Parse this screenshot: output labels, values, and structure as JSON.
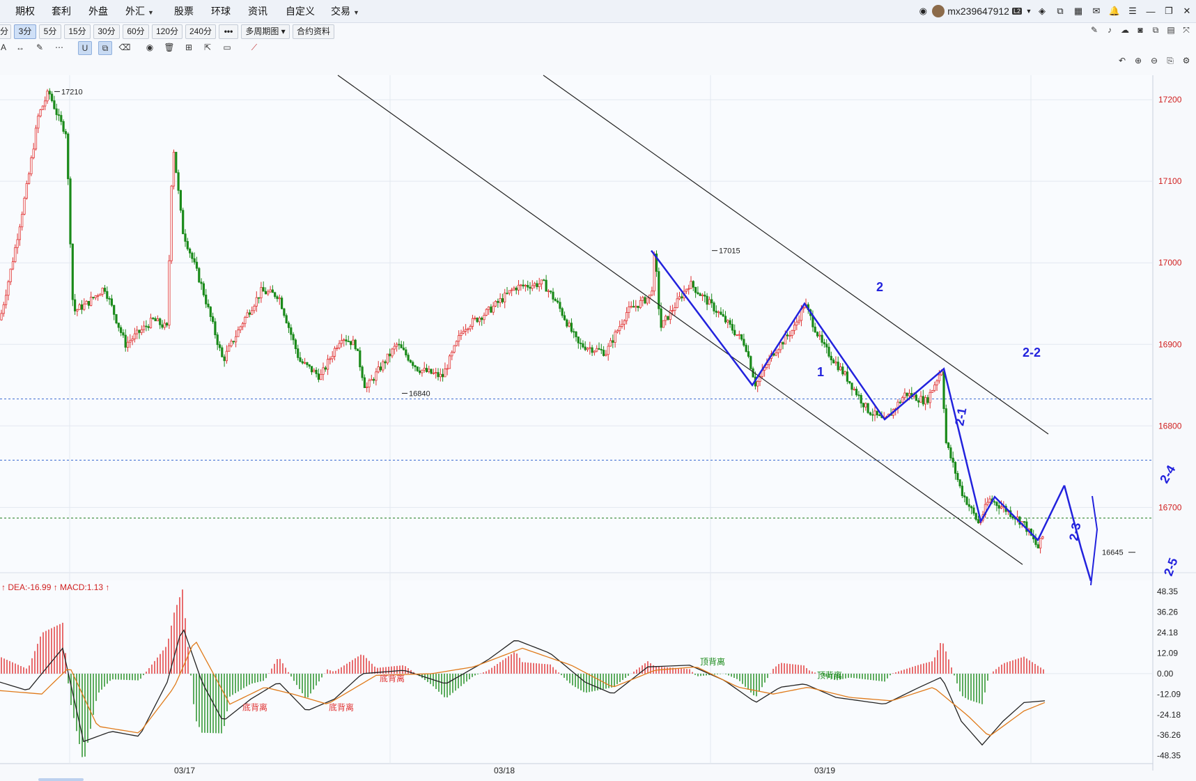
{
  "menu": {
    "items": [
      {
        "label": "期权",
        "caret": false
      },
      {
        "label": "套利",
        "caret": false
      },
      {
        "label": "外盘",
        "caret": false
      },
      {
        "label": "外汇",
        "caret": true
      },
      {
        "label": "股票",
        "caret": false
      },
      {
        "label": "环球",
        "caret": false
      },
      {
        "label": "资讯",
        "caret": false
      },
      {
        "label": "自定义",
        "caret": false
      },
      {
        "label": "交易",
        "caret": true
      }
    ],
    "username": "mx239647912",
    "level_badge": "L2"
  },
  "toolbar": {
    "timeframes": [
      {
        "label": "分",
        "active": false
      },
      {
        "label": "3分",
        "active": true
      },
      {
        "label": "5分",
        "active": false
      },
      {
        "label": "15分",
        "active": false
      },
      {
        "label": "30分",
        "active": false
      },
      {
        "label": "60分",
        "active": false
      },
      {
        "label": "120分",
        "active": false
      },
      {
        "label": "240分",
        "active": false
      },
      {
        "label": "•••",
        "active": false
      },
      {
        "label": "多周期图 ▾",
        "active": false
      },
      {
        "label": "合约资料",
        "active": false
      }
    ]
  },
  "colors": {
    "up": "#e03030",
    "down": "#1a8a1a",
    "drawing": "#2222dd",
    "diff_line": "#222222",
    "dea_line": "#e07a1a"
  },
  "chart_data": {
    "type": "candlestick",
    "x_ticks": [
      "03/17",
      "03/18",
      "03/19"
    ],
    "price_axis": {
      "ticks": [
        17200,
        17100,
        17000,
        16900,
        16800,
        16700
      ],
      "range": [
        16620,
        17230
      ]
    },
    "annotations": {
      "high": "17210",
      "low1": "16840",
      "high2": "17015",
      "low2": "16645"
    },
    "price_series_keypoints": [
      {
        "t": 0,
        "p": 16930
      },
      {
        "t": 20,
        "p": 17010
      },
      {
        "t": 40,
        "p": 17100
      },
      {
        "t": 55,
        "p": 17180
      },
      {
        "t": 70,
        "p": 17210
      },
      {
        "t": 85,
        "p": 17175
      },
      {
        "t": 95,
        "p": 17160
      },
      {
        "t": 105,
        "p": 16940
      },
      {
        "t": 125,
        "p": 16950
      },
      {
        "t": 150,
        "p": 16970
      },
      {
        "t": 180,
        "p": 16900
      },
      {
        "t": 220,
        "p": 16930
      },
      {
        "t": 240,
        "p": 16920
      },
      {
        "t": 248,
        "p": 17150
      },
      {
        "t": 262,
        "p": 17040
      },
      {
        "t": 290,
        "p": 16970
      },
      {
        "t": 320,
        "p": 16880
      },
      {
        "t": 350,
        "p": 16930
      },
      {
        "t": 375,
        "p": 16965
      },
      {
        "t": 400,
        "p": 16960
      },
      {
        "t": 430,
        "p": 16880
      },
      {
        "t": 460,
        "p": 16860
      },
      {
        "t": 490,
        "p": 16910
      },
      {
        "t": 510,
        "p": 16900
      },
      {
        "t": 525,
        "p": 16845
      },
      {
        "t": 545,
        "p": 16870
      },
      {
        "t": 570,
        "p": 16900
      },
      {
        "t": 600,
        "p": 16870
      },
      {
        "t": 635,
        "p": 16860
      },
      {
        "t": 665,
        "p": 16920
      },
      {
        "t": 700,
        "p": 16940
      },
      {
        "t": 740,
        "p": 16970
      },
      {
        "t": 780,
        "p": 16975
      },
      {
        "t": 800,
        "p": 16950
      },
      {
        "t": 830,
        "p": 16900
      },
      {
        "t": 870,
        "p": 16890
      },
      {
        "t": 900,
        "p": 16940
      },
      {
        "t": 935,
        "p": 16960
      },
      {
        "t": 940,
        "p": 17015
      },
      {
        "t": 948,
        "p": 16920
      },
      {
        "t": 990,
        "p": 16975
      },
      {
        "t": 1030,
        "p": 16940
      },
      {
        "t": 1070,
        "p": 16900
      },
      {
        "t": 1085,
        "p": 16850
      },
      {
        "t": 1110,
        "p": 16890
      },
      {
        "t": 1140,
        "p": 16920
      },
      {
        "t": 1155,
        "p": 16950
      },
      {
        "t": 1180,
        "p": 16900
      },
      {
        "t": 1215,
        "p": 16860
      },
      {
        "t": 1245,
        "p": 16820
      },
      {
        "t": 1270,
        "p": 16805
      },
      {
        "t": 1300,
        "p": 16840
      },
      {
        "t": 1330,
        "p": 16830
      },
      {
        "t": 1352,
        "p": 16870
      },
      {
        "t": 1358,
        "p": 16780
      },
      {
        "t": 1380,
        "p": 16720
      },
      {
        "t": 1405,
        "p": 16680
      },
      {
        "t": 1420,
        "p": 16710
      },
      {
        "t": 1440,
        "p": 16700
      },
      {
        "t": 1470,
        "p": 16680
      },
      {
        "t": 1490,
        "p": 16650
      },
      {
        "t": 1500,
        "p": 16670
      }
    ],
    "h_lines": [
      {
        "price": 16833,
        "style": "dashed",
        "color": "#3a6ad0"
      },
      {
        "price": 16758,
        "style": "dashed",
        "color": "#3a6ad0"
      },
      {
        "price": 16687,
        "style": "dashed",
        "color": "#1a7a1a"
      }
    ],
    "trend_lines": [
      {
        "from": {
          "t": 485,
          "p": 17230
        },
        "to": {
          "t": 1468,
          "p": 16630
        }
      },
      {
        "from": {
          "t": 780,
          "p": 17230
        },
        "to": {
          "t": 1505,
          "p": 16790
        }
      }
    ],
    "wave_labels": [
      "1",
      "2",
      "2-1",
      "2-2",
      "2-3",
      "2-4",
      "2-5"
    ],
    "wave_path": [
      {
        "t": 935,
        "p": 17015
      },
      {
        "t": 1080,
        "p": 16850
      },
      {
        "t": 1155,
        "p": 16950
      },
      {
        "t": 1270,
        "p": 16808
      },
      {
        "t": 1355,
        "p": 16870
      },
      {
        "t": 1408,
        "p": 16683
      },
      {
        "t": 1428,
        "p": 16713
      },
      {
        "t": 1490,
        "p": 16660
      },
      {
        "t": 1528,
        "p": 16727
      }
    ],
    "macd": {
      "legend_prefix": "",
      "dea_label": "DEA:-16.99",
      "macd_label": "MACD:1.13",
      "ticks": [
        48.35,
        36.26,
        24.18,
        12.09,
        0.0,
        -12.09,
        -24.18,
        -36.26,
        -48.35
      ],
      "divergence_labels": [
        {
          "text": "底背离",
          "t": 348,
          "v": -20,
          "color": "#e03030"
        },
        {
          "text": "底背离",
          "t": 472,
          "v": -20,
          "color": "#e03030"
        },
        {
          "text": "底背离",
          "t": 545,
          "v": -3,
          "color": "#e03030"
        },
        {
          "text": "顶背离",
          "t": 1005,
          "v": 7,
          "color": "#1a8a1a"
        },
        {
          "text": "顶背离",
          "t": 1173,
          "v": -1,
          "color": "#1a8a1a"
        }
      ],
      "diff_keypoints": [
        {
          "t": 0,
          "v": -5
        },
        {
          "t": 40,
          "v": -10
        },
        {
          "t": 90,
          "v": 15
        },
        {
          "t": 120,
          "v": -40
        },
        {
          "t": 160,
          "v": -34
        },
        {
          "t": 200,
          "v": -37
        },
        {
          "t": 240,
          "v": -5
        },
        {
          "t": 262,
          "v": 28
        },
        {
          "t": 290,
          "v": -5
        },
        {
          "t": 320,
          "v": -28
        },
        {
          "t": 360,
          "v": -15
        },
        {
          "t": 400,
          "v": -5
        },
        {
          "t": 440,
          "v": -22
        },
        {
          "t": 480,
          "v": -15
        },
        {
          "t": 520,
          "v": 0
        },
        {
          "t": 580,
          "v": 2
        },
        {
          "t": 640,
          "v": -6
        },
        {
          "t": 700,
          "v": 8
        },
        {
          "t": 740,
          "v": 20
        },
        {
          "t": 790,
          "v": 12
        },
        {
          "t": 840,
          "v": -5
        },
        {
          "t": 880,
          "v": -12
        },
        {
          "t": 930,
          "v": 4
        },
        {
          "t": 990,
          "v": 5
        },
        {
          "t": 1040,
          "v": -4
        },
        {
          "t": 1085,
          "v": -17
        },
        {
          "t": 1120,
          "v": -8
        },
        {
          "t": 1155,
          "v": -6
        },
        {
          "t": 1200,
          "v": -14
        },
        {
          "t": 1270,
          "v": -18
        },
        {
          "t": 1320,
          "v": -8
        },
        {
          "t": 1352,
          "v": -2
        },
        {
          "t": 1380,
          "v": -28
        },
        {
          "t": 1410,
          "v": -42
        },
        {
          "t": 1440,
          "v": -28
        },
        {
          "t": 1470,
          "v": -17
        },
        {
          "t": 1500,
          "v": -16
        }
      ],
      "dea_keypoints": [
        {
          "t": 0,
          "v": -10
        },
        {
          "t": 60,
          "v": -12
        },
        {
          "t": 100,
          "v": 4
        },
        {
          "t": 140,
          "v": -31
        },
        {
          "t": 200,
          "v": -35
        },
        {
          "t": 250,
          "v": -8
        },
        {
          "t": 280,
          "v": 20
        },
        {
          "t": 330,
          "v": -18
        },
        {
          "t": 380,
          "v": -8
        },
        {
          "t": 420,
          "v": -12
        },
        {
          "t": 470,
          "v": -18
        },
        {
          "t": 540,
          "v": -1
        },
        {
          "t": 620,
          "v": 0
        },
        {
          "t": 680,
          "v": 4
        },
        {
          "t": 750,
          "v": 15
        },
        {
          "t": 820,
          "v": 5
        },
        {
          "t": 880,
          "v": -8
        },
        {
          "t": 940,
          "v": 2
        },
        {
          "t": 1000,
          "v": 4
        },
        {
          "t": 1060,
          "v": -8
        },
        {
          "t": 1110,
          "v": -12
        },
        {
          "t": 1160,
          "v": -8
        },
        {
          "t": 1220,
          "v": -14
        },
        {
          "t": 1280,
          "v": -16
        },
        {
          "t": 1340,
          "v": -8
        },
        {
          "t": 1390,
          "v": -25
        },
        {
          "t": 1420,
          "v": -37
        },
        {
          "t": 1470,
          "v": -22
        },
        {
          "t": 1500,
          "v": -17
        }
      ]
    }
  }
}
